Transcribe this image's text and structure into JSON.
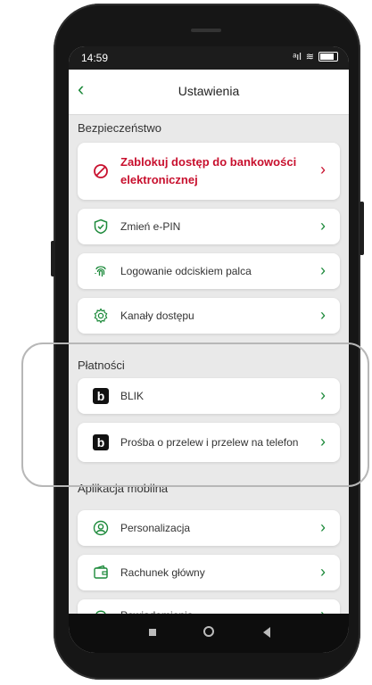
{
  "status": {
    "time": "14:59",
    "signal": "ᵃıl",
    "wifi": "≋"
  },
  "header": {
    "back": "‹",
    "title": "Ustawienia"
  },
  "sections": {
    "security": "Bezpieczeństwo",
    "payments": "Płatności",
    "mobile": "Aplikacja mobilna"
  },
  "security_items": [
    {
      "line1": "Zablokuj dostęp do bankowości",
      "line2": "elektronicznej"
    },
    {
      "label": "Zmień e-PIN"
    },
    {
      "label": "Logowanie odciskiem palca"
    },
    {
      "label": "Kanały dostępu"
    }
  ],
  "payment_items": [
    {
      "label": "BLIK"
    },
    {
      "label": "Prośba o przelew i przelew na telefon"
    }
  ],
  "mobile_items": [
    {
      "label": "Personalizacja"
    },
    {
      "label": "Rachunek główny"
    },
    {
      "label": "Powiadomienia"
    }
  ],
  "icons": {
    "block": "block-icon",
    "shield": "shield-check-icon",
    "fingerprint": "fingerprint-icon",
    "gear": "gear-icon",
    "blik": "b",
    "person": "person-icon",
    "account": "wallet-icon",
    "bell": "bell-icon"
  },
  "chevron": "›",
  "colors": {
    "accent": "#1d8a3b",
    "danger": "#c8102e"
  }
}
